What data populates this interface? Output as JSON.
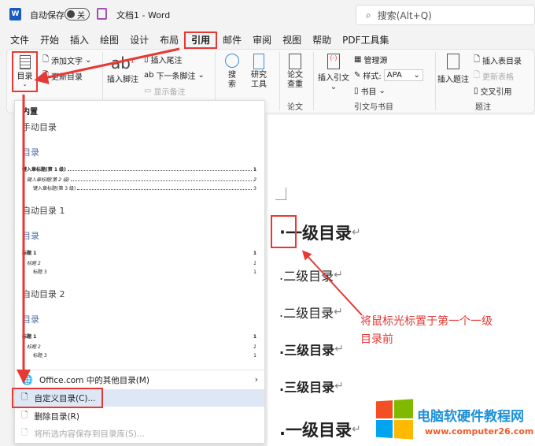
{
  "titlebar": {
    "autosave": "自动保存",
    "toggle": "关",
    "doc_title": "文档1  -  Word",
    "search_placeholder": "搜索(Alt+Q)"
  },
  "tabs": [
    "文件",
    "开始",
    "插入",
    "绘图",
    "设计",
    "布局",
    "引用",
    "邮件",
    "审阅",
    "视图",
    "帮助",
    "PDF工具集"
  ],
  "active_tab": "引用",
  "ribbon": {
    "toc": "目录",
    "add_text": "添加文字",
    "update_toc": "更新目录",
    "insert_footnote": "插入脚注",
    "insert_endnote": "插入尾注",
    "next_footnote": "下一条脚注",
    "show_notes": "显示备注",
    "search": "搜\n索",
    "research": "研究\n工具",
    "paper_check": "论文\n查重",
    "paper_group": "论文",
    "insert_citation": "插入引文",
    "manage_sources": "管理源",
    "style_label": "样式:",
    "style_value": "APA",
    "bibliography": "书目",
    "citations_group": "引文与书目",
    "insert_caption": "插入题注",
    "insert_table_figures": "插入表目录",
    "update_table": "更新表格",
    "cross_ref": "交叉引用",
    "captions_group": "题注"
  },
  "dropdown": {
    "builtin": "内置",
    "manual": "手动目录",
    "manual_title": "目录",
    "manual_lines": [
      {
        "text": "键入章标题(第 1 级)",
        "page": "1"
      },
      {
        "text": "键入章标题(第 2 级)",
        "page": "2"
      },
      {
        "text": "键入章标题(第 3 级)",
        "page": "3"
      }
    ],
    "auto1": "自动目录 1",
    "auto1_title": "目录",
    "auto1_lines": [
      {
        "text": "标题 1",
        "page": "1"
      },
      {
        "text": "标题 2",
        "page": "1"
      },
      {
        "text": "标题 3",
        "page": "1"
      }
    ],
    "auto2": "自动目录 2",
    "auto2_title": "目录",
    "auto2_lines": [
      {
        "text": "标题 1",
        "page": "1"
      },
      {
        "text": "标题 2",
        "page": "1"
      },
      {
        "text": "标题 3",
        "page": "1"
      }
    ],
    "more": "Office.com 中的其他目录(M)",
    "custom": "自定义目录(C)...",
    "remove": "删除目录(R)",
    "save_selection": "将所选内容保存到目录库(S)..."
  },
  "document": {
    "lines": [
      "一级目录",
      "二级目录",
      "二级目录",
      "三级目录",
      "三级目录",
      "一级目录"
    ],
    "return_mark": "↵"
  },
  "annotation": [
    "将鼠标光标置于第一个一级",
    "目录前"
  ],
  "watermark": {
    "name": "电脑软硬件教程网",
    "url": "www.computer26.com"
  },
  "colors": {
    "accent_red": "#e53935",
    "word_blue": "#185abd",
    "hover": "#dde7f5"
  }
}
